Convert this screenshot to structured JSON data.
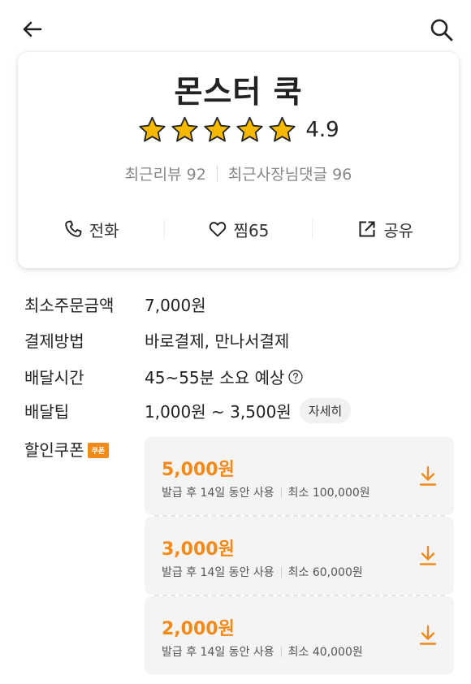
{
  "header": {
    "back_icon": "arrow-left-icon",
    "search_icon": "search-icon"
  },
  "store": {
    "name": "몬스터 쿡",
    "rating": "4.9",
    "stars": 5,
    "star_color": "#f5b800",
    "recent_reviews": "최근리뷰 92",
    "owner_replies": "최근사장님댓글 96",
    "actions": {
      "call_label": "전화",
      "like_label": "찜65",
      "share_label": "공유"
    }
  },
  "info": {
    "min_order_label": "최소주문금액",
    "min_order_value": "7,000원",
    "payment_label": "결제방법",
    "payment_value": "바로결제, 만나서결제",
    "delivery_time_label": "배달시간",
    "delivery_time_value": "45~55분 소요 예상",
    "delivery_tip_label": "배달팁",
    "delivery_tip_value": "1,000원 ~ 3,500원",
    "detail_label": "자세히",
    "coupon_label": "할인쿠폰",
    "coupon_badge": "쿠폰"
  },
  "coupons": [
    {
      "amount": "5,000원",
      "period": "발급 후 14일 동안 사용",
      "minimum": "최소 100,000원"
    },
    {
      "amount": "3,000원",
      "period": "발급 후 14일 동안 사용",
      "minimum": "최소 60,000원"
    },
    {
      "amount": "2,000원",
      "period": "발급 후 14일 동안 사용",
      "minimum": "최소 40,000원"
    }
  ],
  "colors": {
    "accent": "#f28a1b",
    "text": "#222222",
    "muted": "#888888"
  }
}
